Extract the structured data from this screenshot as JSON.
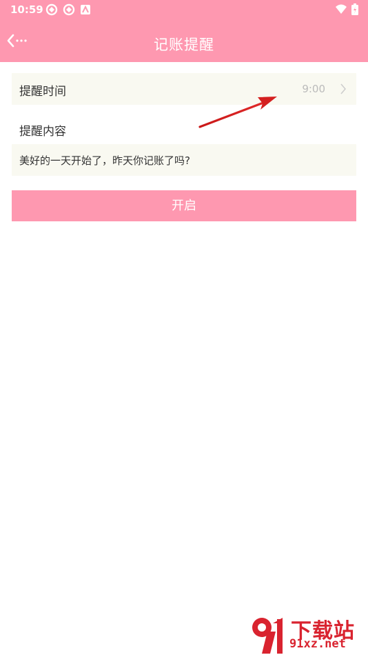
{
  "status_bar": {
    "time": "10:59"
  },
  "app_bar": {
    "title": "记账提醒"
  },
  "reminder_time": {
    "label": "提醒时间",
    "value": "9:00"
  },
  "reminder_content": {
    "label": "提醒内容",
    "text": "美好的一天开始了，昨天你记账了吗?"
  },
  "enable_button": {
    "label": "开启"
  },
  "watermark": {
    "title": "下载站",
    "domain": "91xz.net"
  },
  "colors": {
    "accent": "#fe98b0",
    "row_background": "#f9f9f1",
    "annotation_arrow": "#d42020",
    "watermark": "#d9232f"
  },
  "icons": [
    "back-icon",
    "chevron-right-icon",
    "wifi-icon",
    "battery-icon",
    "notification-icon"
  ]
}
